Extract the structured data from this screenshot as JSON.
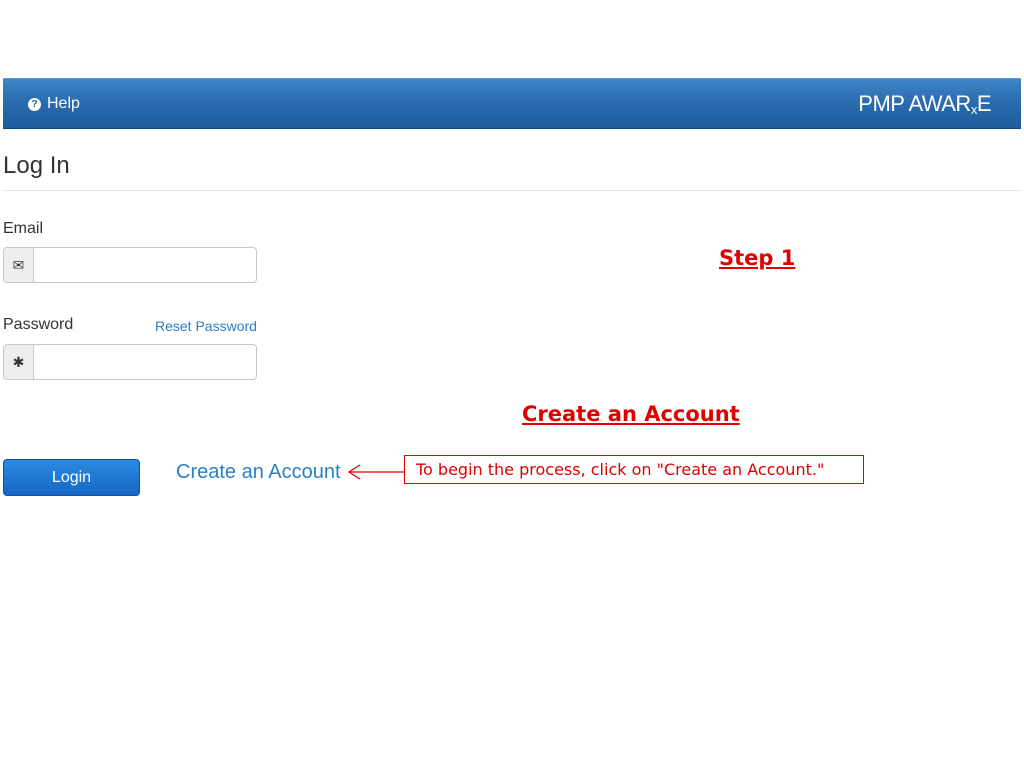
{
  "header": {
    "help_icon": "question-circle-icon",
    "help_label": "Help",
    "brand_main": "PMP AWAR",
    "brand_sub": "x",
    "brand_end": "E"
  },
  "page": {
    "title": "Log In"
  },
  "form": {
    "email_label": "Email",
    "email_icon": "envelope-icon",
    "email_value": "",
    "password_label": "Password",
    "password_icon": "asterisk-icon",
    "password_value": "",
    "reset_link": "Reset Password",
    "login_button": "Login",
    "create_account_link": "Create an Account"
  },
  "annotations": {
    "step": "Step 1",
    "heading": "Create an Account",
    "callout": "To begin the process, click on \"Create an  Account.\"",
    "color": "#e00000"
  },
  "colors": {
    "header_bar": "#2a6db0",
    "link": "#2a7fc4",
    "button": "#1667c3"
  }
}
